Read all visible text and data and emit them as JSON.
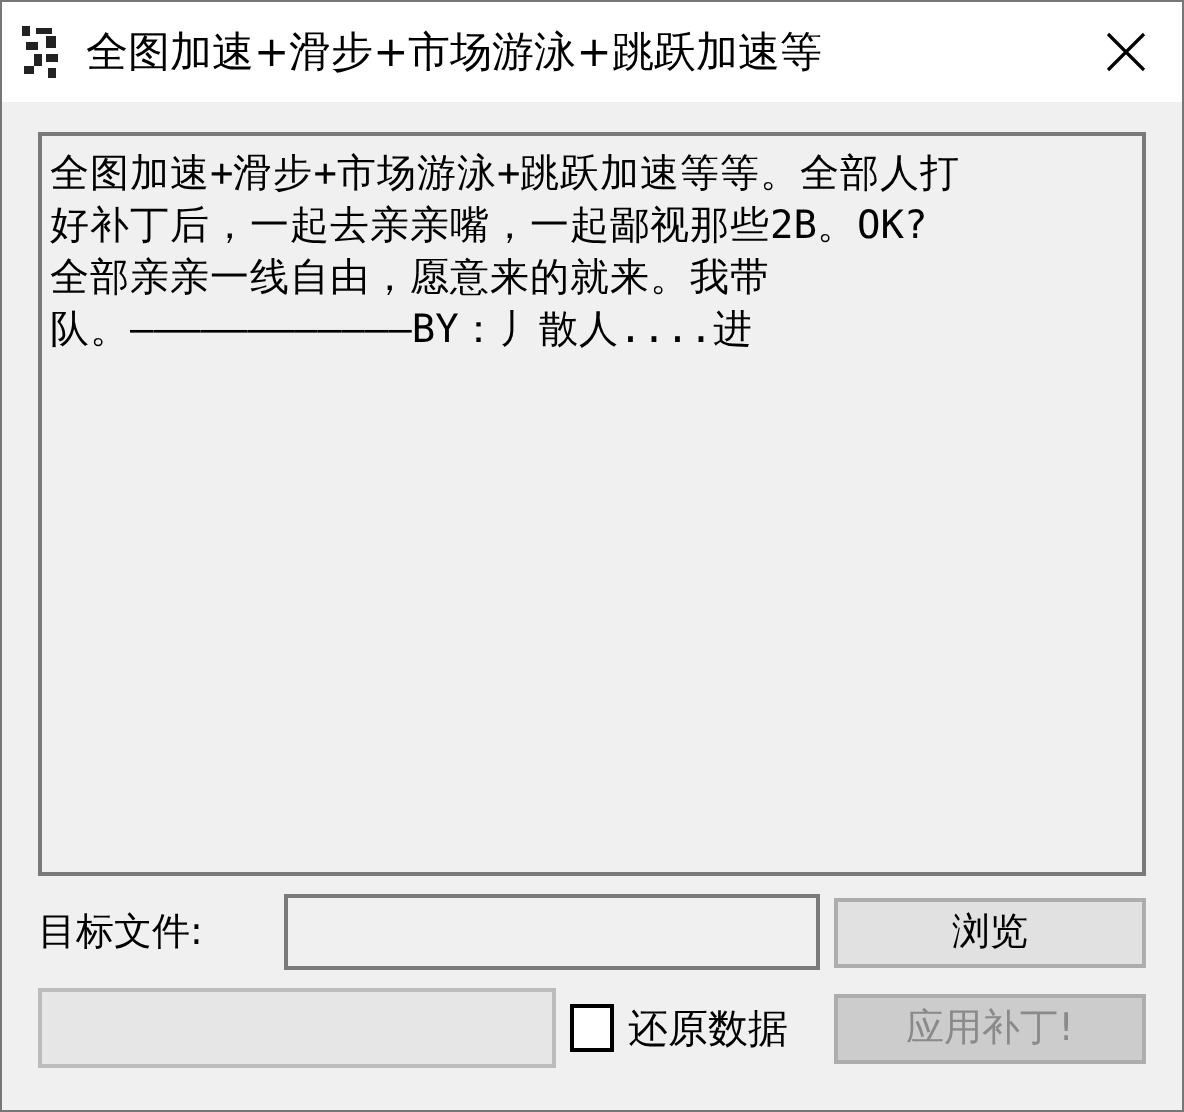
{
  "window": {
    "title": "全图加速+滑步+市场游泳+跳跃加速等"
  },
  "message": {
    "lines": [
      "全图加速+滑步+市场游泳+跳跃加速等等。全部人打",
      "好补丁后，一起去亲亲嘴，一起鄙视那些2B。OK?",
      "全部亲亲一线自由，愿意来的就来。我带",
      "队。————————————BY：丿散人....进"
    ]
  },
  "target": {
    "label": "目标文件:",
    "browse": "浏览"
  },
  "restore": {
    "label": "还原数据",
    "checked": false
  },
  "apply": {
    "label": "应用补丁!",
    "disabled": true
  }
}
